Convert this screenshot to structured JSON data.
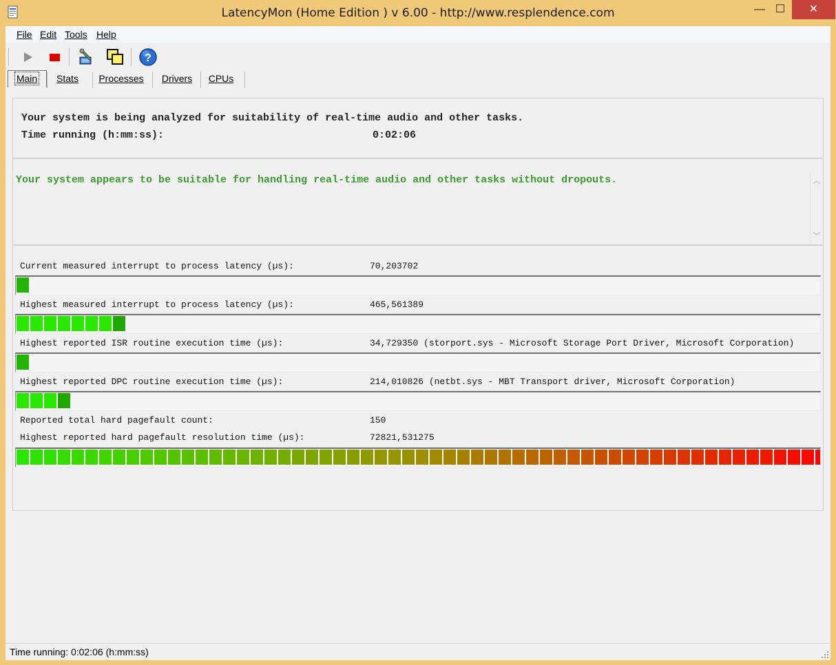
{
  "window": {
    "title": "LatencyMon  (Home Edition )  v 6.00 - http://www.resplendence.com",
    "minimize": "—",
    "maximize": "☐",
    "close": "✕"
  },
  "menu": {
    "file": "File",
    "edit": "Edit",
    "tools": "Tools",
    "help": "Help"
  },
  "toolbar": {
    "start_icon": "play-icon",
    "stop_icon": "stop-icon",
    "wrench_icon": "wrench-icon",
    "window_icon": "windows-icon",
    "help_icon": "help-icon",
    "colors": {
      "play": "#8e8e8e",
      "stop": "#e00000",
      "help": "#2a6fd0"
    }
  },
  "tabs": [
    {
      "label": "Main",
      "active": true
    },
    {
      "label": "Stats"
    },
    {
      "label": "Processes"
    },
    {
      "label": "Drivers"
    },
    {
      "label": "CPUs"
    }
  ],
  "analysis": {
    "line1": "Your system is being analyzed for suitability of real-time audio and other tasks.",
    "time_label": "Time running (h:mm:ss):",
    "time_value": "0:02:06"
  },
  "verdict": {
    "text": "Your system appears to be suitable for handling real-time audio and other tasks without dropouts.",
    "color": "#3a9a2e"
  },
  "metrics": [
    {
      "label": "Current measured interrupt to process latency (µs):",
      "value": "70,203702",
      "level_segments": 1
    },
    {
      "label": "Highest measured interrupt to process latency (µs):",
      "value": "465,561389",
      "level_segments": 8
    },
    {
      "label": "Highest reported ISR routine execution time (µs):",
      "value": "34,729350   (storport.sys - Microsoft Storage Port Driver, Microsoft Corporation)",
      "level_segments": 1
    },
    {
      "label": "Highest reported DPC routine execution time (µs):",
      "value": "214,010826   (netbt.sys - MBT Transport driver, Microsoft Corporation)",
      "level_segments": 4
    }
  ],
  "pagefault": {
    "count_label": "Reported total hard pagefault count:",
    "count_value": "150",
    "res_label": "Highest reported hard pagefault resolution time (µs):",
    "res_value": "72821,531275",
    "level_segments": 60
  },
  "statusbar": {
    "text": "Time running: 0:02:06  (h:mm:ss)"
  }
}
